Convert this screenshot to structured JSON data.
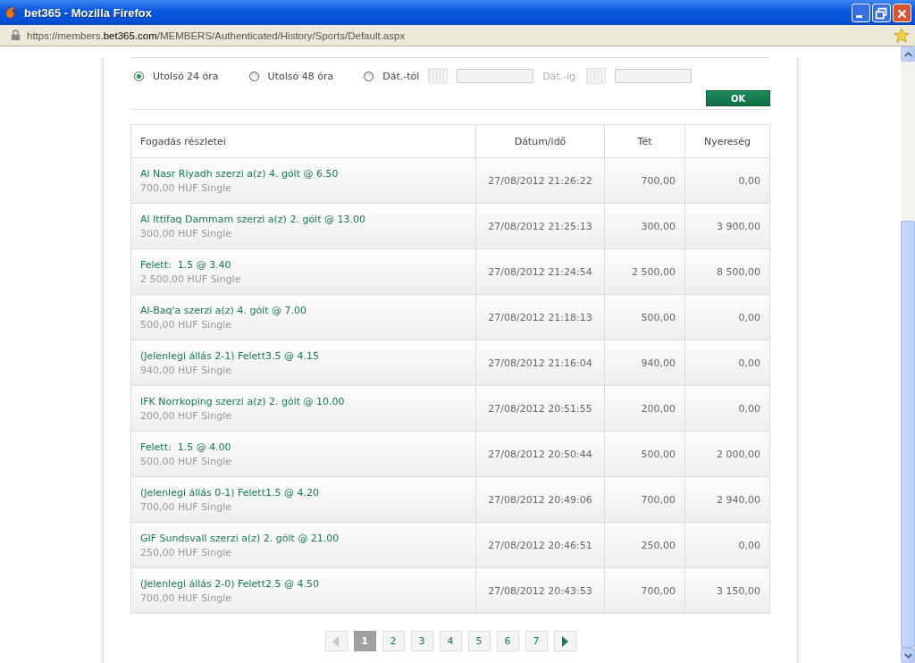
{
  "window": {
    "title": "bet365 - Mozilla Firefox"
  },
  "address_bar": {
    "prefix": "https://members.",
    "domain": "bet365.com",
    "path": "/MEMBERS/Authenticated/History/Sports/Default.aspx"
  },
  "filters": [
    {
      "label": "Utolsó 24 óra",
      "selected": true
    },
    {
      "label": "Utolsó 48 óra",
      "selected": false
    },
    {
      "label": "Dát.-tól",
      "selected": false
    }
  ],
  "date_to_label": "Dát.-ig",
  "ok_button": "OK",
  "table": {
    "columns": [
      "Fogadás részletei",
      "Dátum/idő",
      "Tét",
      "Nyereség"
    ],
    "rows": [
      {
        "bet": "Al Nasr Riyadh szerzi a(z) 4. gólt @ 6.50",
        "detail": "700,00 HUF Single",
        "datetime": "27/08/2012 21:26:22",
        "stake": "700,00",
        "return": "0,00"
      },
      {
        "bet": "Al Ittifaq Dammam szerzi a(z) 2. gólt @ 13.00",
        "detail": "300,00 HUF Single",
        "datetime": "27/08/2012 21:25:13",
        "stake": "300,00",
        "return": "3 900,00"
      },
      {
        "bet": "Felett:  1.5 @ 3.40",
        "detail": "2 500,00 HUF Single",
        "datetime": "27/08/2012 21:24:54",
        "stake": "2 500,00",
        "return": "8 500,00"
      },
      {
        "bet": "Al-Baq'a szerzi a(z) 4. gólt @ 7.00",
        "detail": "500,00 HUF Single",
        "datetime": "27/08/2012 21:18:13",
        "stake": "500,00",
        "return": "0,00"
      },
      {
        "bet": "(Jelenlegi állás 2-1) Felett3.5 @ 4.15",
        "detail": "940,00 HUF Single",
        "datetime": "27/08/2012 21:16:04",
        "stake": "940,00",
        "return": "0,00"
      },
      {
        "bet": "IFK Norrkoping szerzi a(z) 2. gólt @ 10.00",
        "detail": "200,00 HUF Single",
        "datetime": "27/08/2012 20:51:55",
        "stake": "200,00",
        "return": "0,00"
      },
      {
        "bet": "Felett:  1.5 @ 4.00",
        "detail": "500,00 HUF Single",
        "datetime": "27/08/2012 20:50:44",
        "stake": "500,00",
        "return": "2 000,00"
      },
      {
        "bet": "(Jelenlegi állás 0-1) Felett1.5 @ 4.20",
        "detail": "700,00 HUF Single",
        "datetime": "27/08/2012 20:49:06",
        "stake": "700,00",
        "return": "2 940,00"
      },
      {
        "bet": "GIF Sundsvall szerzi a(z) 2. gólt @ 21.00",
        "detail": "250,00 HUF Single",
        "datetime": "27/08/2012 20:46:51",
        "stake": "250,00",
        "return": "0,00"
      },
      {
        "bet": "(Jelenlegi állás 2-0) Felett2.5 @ 4.50",
        "detail": "700,00 HUF Single",
        "datetime": "27/08/2012 20:43:53",
        "stake": "700,00",
        "return": "3 150,00"
      }
    ]
  },
  "pagination": {
    "prev_disabled": true,
    "pages": [
      {
        "label": "1",
        "selected": true
      },
      {
        "label": "2",
        "selected": false
      },
      {
        "label": "3",
        "selected": false
      },
      {
        "label": "4",
        "selected": false
      },
      {
        "label": "5",
        "selected": false
      },
      {
        "label": "6",
        "selected": false
      },
      {
        "label": "7",
        "selected": false
      }
    ],
    "next_disabled": false
  }
}
